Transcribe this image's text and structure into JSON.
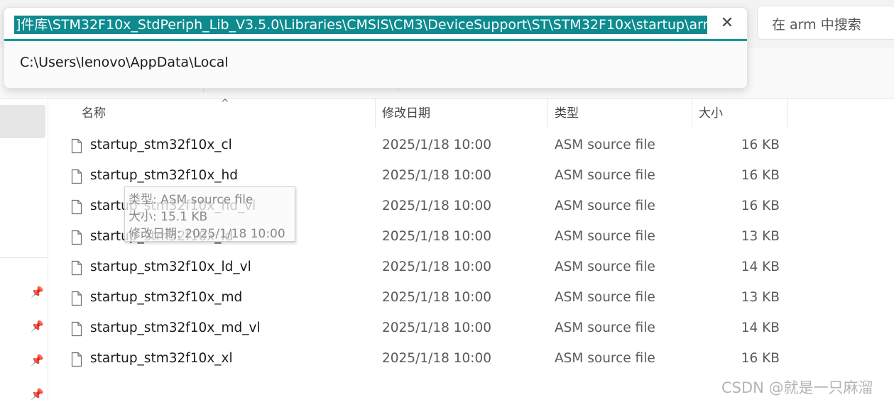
{
  "address_bar": {
    "path": "]件库\\STM32F10x_StdPeriph_Lib_V3.5.0\\Libraries\\CMSIS\\CM3\\DeviceSupport\\ST\\STM32F10x\\startup\\arm",
    "clear_glyph": "✕",
    "suggestions": [
      "C:\\Users\\lenovo\\AppData\\Local"
    ]
  },
  "search": {
    "placeholder": "在 arm 中搜索"
  },
  "columns": {
    "name": "名称",
    "date": "修改日期",
    "type": "类型",
    "size": "大小",
    "sort_indicator": "^"
  },
  "files": [
    {
      "name": "startup_stm32f10x_cl",
      "date": "2025/1/18 10:00",
      "type": "ASM source file",
      "size": "16 KB"
    },
    {
      "name": "startup_stm32f10x_hd",
      "date": "2025/1/18 10:00",
      "type": "ASM source file",
      "size": "16 KB"
    },
    {
      "name": "startup_stm32f10x_hd_vl",
      "date": "2025/1/18 10:00",
      "type": "ASM source file",
      "size": "16 KB"
    },
    {
      "name": "startup_stm32f10x_ld",
      "date": "2025/1/18 10:00",
      "type": "ASM source file",
      "size": "13 KB"
    },
    {
      "name": "startup_stm32f10x_ld_vl",
      "date": "2025/1/18 10:00",
      "type": "ASM source file",
      "size": "14 KB"
    },
    {
      "name": "startup_stm32f10x_md",
      "date": "2025/1/18 10:00",
      "type": "ASM source file",
      "size": "13 KB"
    },
    {
      "name": "startup_stm32f10x_md_vl",
      "date": "2025/1/18 10:00",
      "type": "ASM source file",
      "size": "14 KB"
    },
    {
      "name": "startup_stm32f10x_xl",
      "date": "2025/1/18 10:00",
      "type": "ASM source file",
      "size": "16 KB"
    }
  ],
  "tooltip": {
    "type_line": "类型: ASM source file",
    "size_line": "大小: 15.1 KB",
    "date_line": "修改日期: 2025/1/18 10:00"
  },
  "nav": {
    "pin_icon": "pin-icon",
    "pin_count": 4
  },
  "watermark": "CSDN @就是一只麻溜",
  "colors": {
    "address_highlight": "#0e8b8f",
    "accent_underline": "#0f9a9c"
  }
}
